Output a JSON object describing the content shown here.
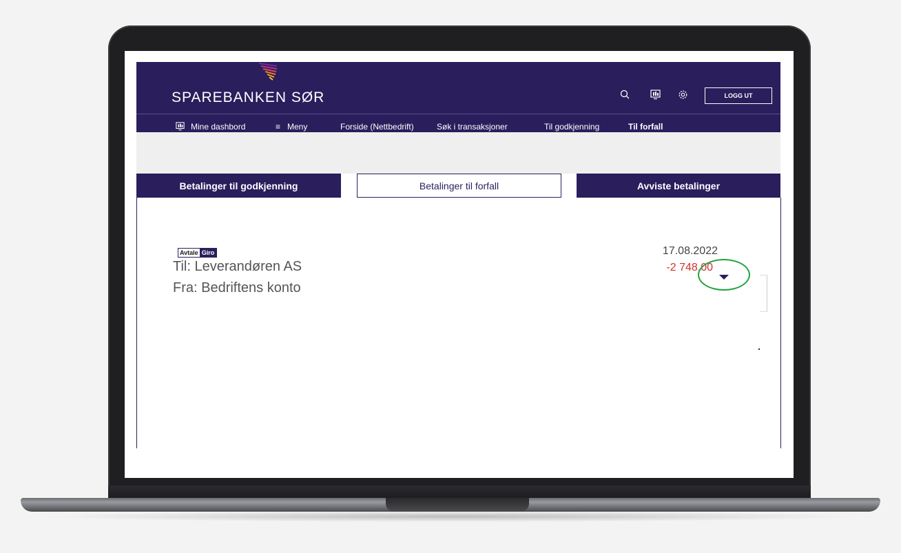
{
  "header": {
    "brand": "SPAREBANKEN SØR",
    "icons": [
      "search-icon",
      "dashboard-icon",
      "gear-icon"
    ],
    "logout_label": "LOGG UT"
  },
  "nav": {
    "items": [
      {
        "label": "Mine dashbord",
        "icon": "dashboard-icon"
      },
      {
        "label": "Meny",
        "icon": "hamburger-icon"
      },
      {
        "label": "Forside (Nettbedrift)"
      },
      {
        "label": "Søk i transaksjoner"
      },
      {
        "label": "Til godkjenning"
      },
      {
        "label": "Til forfall",
        "active": true
      }
    ]
  },
  "tabs": [
    {
      "label": "Betalinger til godkjenning"
    },
    {
      "label": "Betalinger til forfall",
      "selected": true
    },
    {
      "label": "Avviste betalinger"
    }
  ],
  "payment": {
    "badge_left": "Avtale",
    "badge_right": "Giro",
    "to": "Til: Leverandøren AS",
    "from": "Fra: Bedriftens konto",
    "date": "17.08.2022",
    "amount": "-2 748,00"
  },
  "colors": {
    "brand_purple": "#2a1e5c",
    "negative_amount": "#d0312d",
    "highlight": "#1fa33b"
  }
}
